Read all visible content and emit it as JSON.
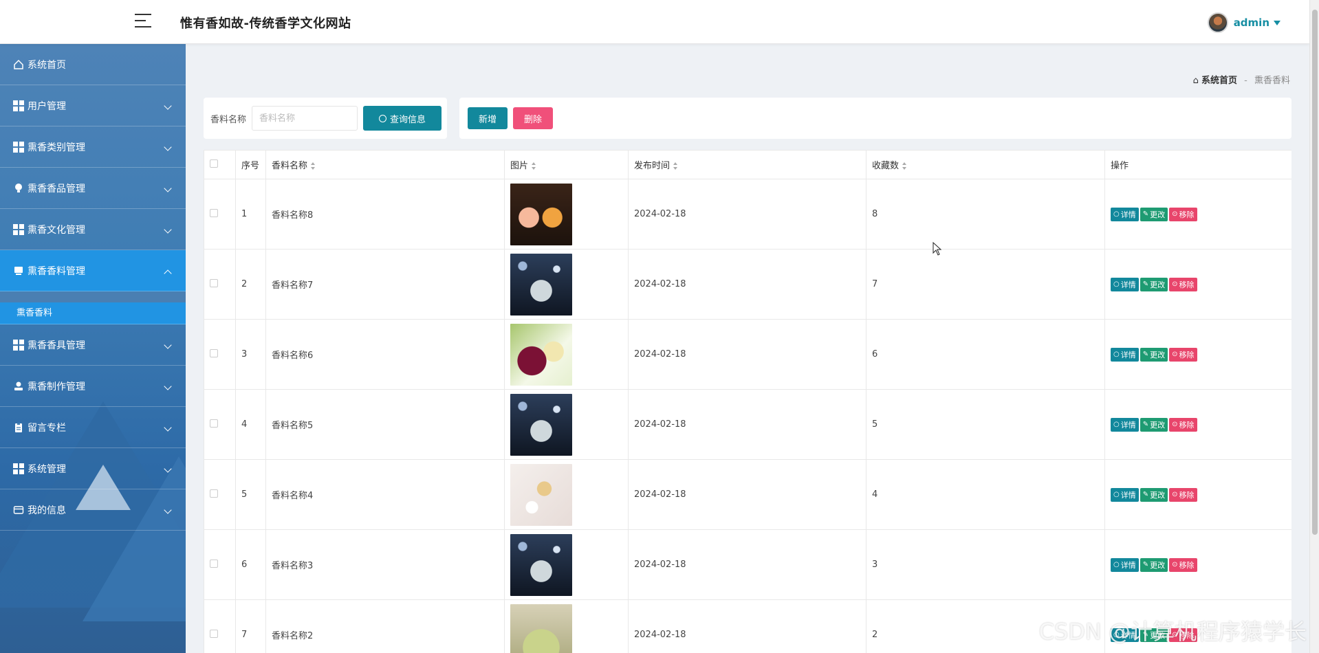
{
  "header": {
    "title": "惟有香如故-传统香学文化网站",
    "username": "admin"
  },
  "sidebar": {
    "items": [
      {
        "label": "系统首页",
        "icon": "home-icon"
      },
      {
        "label": "用户管理",
        "icon": "grid-icon"
      },
      {
        "label": "熏香类别管理",
        "icon": "grid-icon"
      },
      {
        "label": "熏香香品管理",
        "icon": "bulb-icon"
      },
      {
        "label": "熏香文化管理",
        "icon": "grid-icon"
      },
      {
        "label": "熏香香料管理",
        "icon": "monitor-icon",
        "expanded": true
      },
      {
        "label": "熏香香具管理",
        "icon": "grid-icon"
      },
      {
        "label": "熏香制作管理",
        "icon": "user-icon"
      },
      {
        "label": "留言专栏",
        "icon": "clipboard-icon"
      },
      {
        "label": "系统管理",
        "icon": "grid-icon"
      },
      {
        "label": "我的信息",
        "icon": "card-icon"
      }
    ],
    "submenu": {
      "label": "熏香香料"
    }
  },
  "breadcrumb": {
    "home": "系统首页",
    "separator": "-",
    "current": "熏香香料"
  },
  "search": {
    "label": "香料名称",
    "placeholder": "香料名称",
    "button": "查询信息"
  },
  "actions": {
    "add": "新增",
    "delete": "删除"
  },
  "table": {
    "columns": [
      "序号",
      "香料名称",
      "图片",
      "发布时间",
      "收藏数",
      "操作"
    ],
    "rows": [
      {
        "no": "1",
        "name": "香料名称8",
        "date": "2024-02-18",
        "fav": "8",
        "img": "perfume-bottles-amber"
      },
      {
        "no": "2",
        "name": "香料名称7",
        "date": "2024-02-18",
        "fav": "7",
        "img": "perfume-bottle-glass"
      },
      {
        "no": "3",
        "name": "香料名称6",
        "date": "2024-02-18",
        "fav": "6",
        "img": "perfume-bottles-floral"
      },
      {
        "no": "4",
        "name": "香料名称5",
        "date": "2024-02-18",
        "fav": "5",
        "img": "perfume-bottle-glass"
      },
      {
        "no": "5",
        "name": "香料名称4",
        "date": "2024-02-18",
        "fav": "4",
        "img": "perfume-bottle-white"
      },
      {
        "no": "6",
        "name": "香料名称3",
        "date": "2024-02-18",
        "fav": "3",
        "img": "perfume-bottle-glass"
      },
      {
        "no": "7",
        "name": "香料名称2",
        "date": "2024-02-18",
        "fav": "2",
        "img": "perfume-bottle-green"
      }
    ],
    "ops": {
      "detail": "详情",
      "edit": "更改",
      "remove": "移除"
    }
  },
  "watermark": "CSDN @计算机程序猿学长"
}
